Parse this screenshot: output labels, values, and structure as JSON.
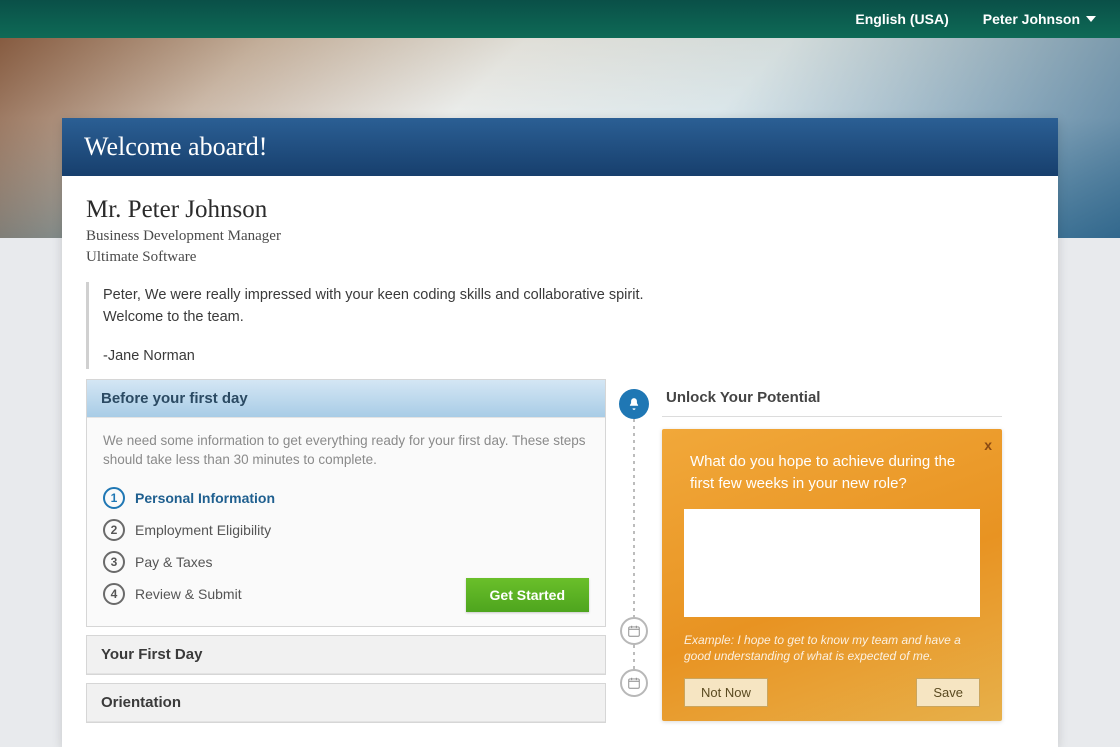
{
  "topbar": {
    "language": "English (USA)",
    "user_name": "Peter Johnson"
  },
  "card": {
    "header": "Welcome aboard!",
    "person_name": "Mr. Peter Johnson",
    "role": "Business Development Manager",
    "company": "Ultimate Software",
    "message_line1": "Peter, We were really impressed with your keen coding skills and collaborative spirit.",
    "message_line2": "Welcome to the team.",
    "signature": "-Jane Norman"
  },
  "before": {
    "title": "Before your first day",
    "desc": "We need some information to get everything ready for your first day. These steps should take less than 30 minutes to complete.",
    "steps": [
      {
        "n": "1",
        "label": "Personal Information",
        "active": true
      },
      {
        "n": "2",
        "label": "Employment Eligibility",
        "active": false
      },
      {
        "n": "3",
        "label": "Pay & Taxes",
        "active": false
      },
      {
        "n": "4",
        "label": "Review & Submit",
        "active": false
      }
    ],
    "cta": "Get Started"
  },
  "sections": {
    "first_day": "Your First Day",
    "orientation": "Orientation"
  },
  "widget": {
    "title": "Unlock Your Potential",
    "question": "What do you hope to achieve during the first few weeks in your new role?",
    "hint": "Example: I hope to get to know my team and have a good understanding of what is expected of me.",
    "not_now": "Not Now",
    "save": "Save",
    "close": "x"
  }
}
